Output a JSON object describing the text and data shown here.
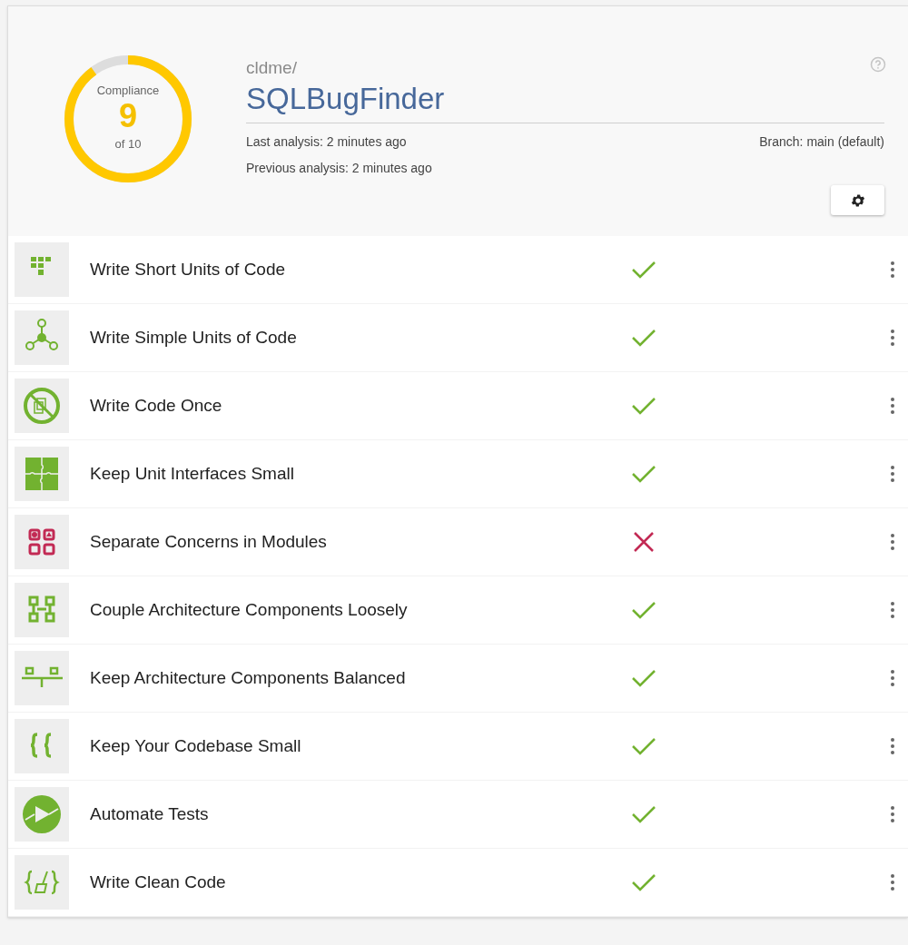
{
  "score": {
    "label": "Compliance",
    "value": "9",
    "of": "of 10"
  },
  "project": {
    "owner": "cldme/",
    "name": "SQLBugFinder",
    "last_analysis": "Last analysis: 2 minutes ago",
    "previous_analysis": "Previous analysis: 2 minutes ago",
    "branch": "Branch: main (default)"
  },
  "guidelines": [
    {
      "title": "Write Short Units of Code",
      "passed": true
    },
    {
      "title": "Write Simple Units of Code",
      "passed": true
    },
    {
      "title": "Write Code Once",
      "passed": true
    },
    {
      "title": "Keep Unit Interfaces Small",
      "passed": true
    },
    {
      "title": "Separate Concerns in Modules",
      "passed": false
    },
    {
      "title": "Couple Architecture Components Loosely",
      "passed": true
    },
    {
      "title": "Keep Architecture Components Balanced",
      "passed": true
    },
    {
      "title": "Keep Your Codebase Small",
      "passed": true
    },
    {
      "title": "Automate Tests",
      "passed": true
    },
    {
      "title": "Write Clean Code",
      "passed": true
    }
  ]
}
